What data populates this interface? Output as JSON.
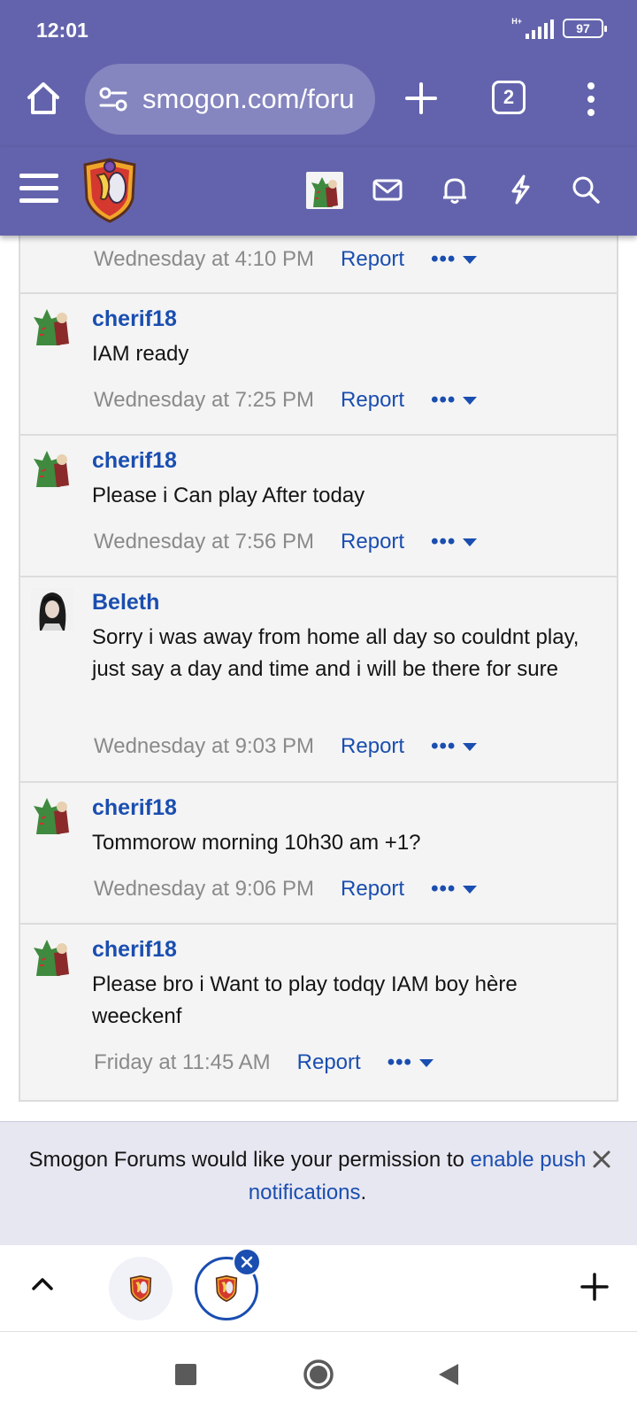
{
  "status_bar": {
    "time": "12:01",
    "network": "H+",
    "battery": "97"
  },
  "browser": {
    "url": "smogon.com/foru",
    "tab_count": "2"
  },
  "posts": [
    {
      "author": "",
      "body": "",
      "time": "Wednesday at 4:10 PM",
      "report": "Report",
      "avatar": "none"
    },
    {
      "author": "cherif18",
      "body": "IAM ready",
      "time": "Wednesday at 7:25 PM",
      "report": "Report",
      "avatar": "tyranitar"
    },
    {
      "author": "cherif18",
      "body": "Please i Can play After today",
      "time": "Wednesday at 7:56 PM",
      "report": "Report",
      "avatar": "tyranitar"
    },
    {
      "author": "Beleth",
      "body": "Sorry i was away from home all day so couldnt play, just say a day and time and i will be there for sure",
      "time": "Wednesday at 9:03 PM",
      "report": "Report",
      "avatar": "dark-hair-character"
    },
    {
      "author": "cherif18",
      "body": "Tommorow morning 10h30 am +1?",
      "time": "Wednesday at 9:06 PM",
      "report": "Report",
      "avatar": "tyranitar"
    },
    {
      "author": "cherif18",
      "body": "Please bro i Want to play todqy IAM boy hère weeckenf",
      "time": "Friday at 11:45 AM",
      "report": "Report",
      "avatar": "tyranitar"
    }
  ],
  "push_banner": {
    "text_before": "Smogon Forums would like your permission to ",
    "link": "enable push notifications",
    "text_after": "."
  },
  "colors": {
    "header": "#6363ad",
    "link": "#1a4eb0",
    "post_bg": "#f4f4f4"
  }
}
